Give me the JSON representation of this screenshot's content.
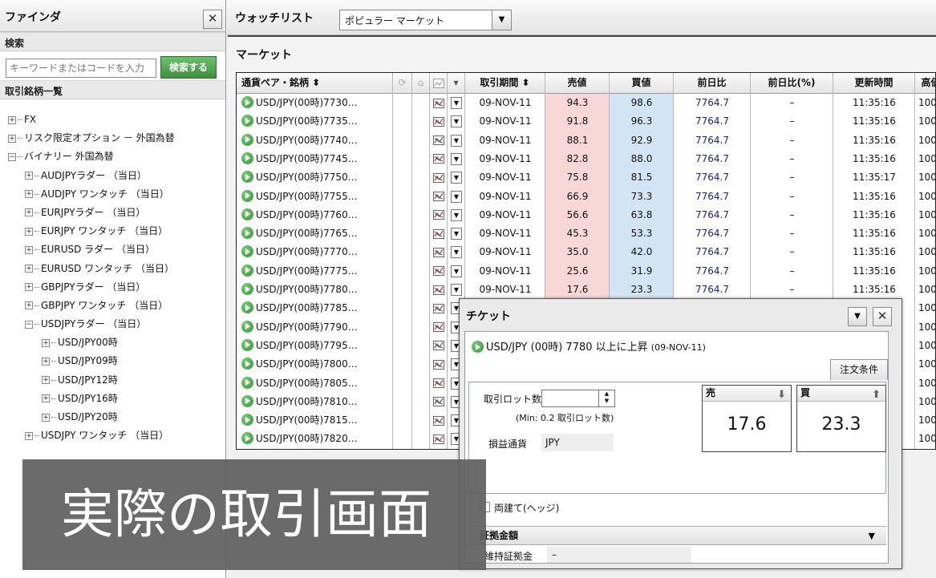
{
  "finder": {
    "title": "ファインダ",
    "close_label": "✕",
    "search_section": "検索",
    "search_placeholder": "キーワードまたはコードを入力",
    "search_button": "検索する",
    "list_section": "取引銘柄一覧",
    "tree": [
      {
        "level": 0,
        "label": "FX",
        "box": "+"
      },
      {
        "level": 0,
        "label": "リスク限定オプション － 外国為替",
        "box": "+"
      },
      {
        "level": 0,
        "label": "バイナリー 外国為替",
        "box": "−"
      },
      {
        "level": 1,
        "label": "AUDJPYラダー （当日）",
        "box": "+"
      },
      {
        "level": 1,
        "label": "AUDJPY ワンタッチ （当日）",
        "box": "+"
      },
      {
        "level": 1,
        "label": "EURJPYラダー （当日）",
        "box": "+"
      },
      {
        "level": 1,
        "label": "EURJPY ワンタッチ （当日）",
        "box": "+"
      },
      {
        "level": 1,
        "label": "EURUSD ラダー （当日）",
        "box": "+"
      },
      {
        "level": 1,
        "label": "EURUSD ワンタッチ （当日）",
        "box": "+"
      },
      {
        "level": 1,
        "label": "GBPJPYラダー （当日）",
        "box": "+"
      },
      {
        "level": 1,
        "label": "GBPJPY ワンタッチ （当日）",
        "box": "+"
      },
      {
        "level": 1,
        "label": "USDJPYラダー （当日）",
        "box": "−"
      },
      {
        "level": 2,
        "label": "USD/JPY00時",
        "box": "+"
      },
      {
        "level": 2,
        "label": "USD/JPY09時",
        "box": "+"
      },
      {
        "level": 2,
        "label": "USD/JPY12時",
        "box": "+"
      },
      {
        "level": 2,
        "label": "USD/JPY16時",
        "box": "+"
      },
      {
        "level": 2,
        "label": "USD/JPY20時",
        "box": "+"
      },
      {
        "level": 1,
        "label": "USDJPY ワンタッチ （当日）",
        "box": "+"
      }
    ]
  },
  "watchlist": {
    "title": "ウォッチリスト",
    "selected": "ポピュラー マーケット",
    "caret": "▼"
  },
  "market": {
    "title": "マーケット",
    "headers": [
      "通貨ペア・銘柄 ⬍",
      "",
      "",
      "",
      "▾",
      "取引期間 ⬍",
      "売値",
      "買値",
      "前日比",
      "前日比(%)",
      "更新時間",
      "高値"
    ],
    "rows": [
      {
        "sym": "USD/JPY(00時)7730…",
        "date": "09-NOV-11",
        "sell": "94.3",
        "buy": "98.6",
        "chg": "7764.7",
        "pct": "–",
        "time": "11:35:16",
        "high": "100"
      },
      {
        "sym": "USD/JPY(00時)7735…",
        "date": "09-NOV-11",
        "sell": "91.8",
        "buy": "96.3",
        "chg": "7764.7",
        "pct": "–",
        "time": "11:35:16",
        "high": "100"
      },
      {
        "sym": "USD/JPY(00時)7740…",
        "date": "09-NOV-11",
        "sell": "88.1",
        "buy": "92.9",
        "chg": "7764.7",
        "pct": "–",
        "time": "11:35:16",
        "high": "100"
      },
      {
        "sym": "USD/JPY(00時)7745…",
        "date": "09-NOV-11",
        "sell": "82.8",
        "buy": "88.0",
        "chg": "7764.7",
        "pct": "–",
        "time": "11:35:16",
        "high": "100"
      },
      {
        "sym": "USD/JPY(00時)7750…",
        "date": "09-NOV-11",
        "sell": "75.8",
        "buy": "81.5",
        "chg": "7764.7",
        "pct": "–",
        "time": "11:35:17",
        "high": "100"
      },
      {
        "sym": "USD/JPY(00時)7755…",
        "date": "09-NOV-11",
        "sell": "66.9",
        "buy": "73.3",
        "chg": "7764.7",
        "pct": "–",
        "time": "11:35:16",
        "high": "100"
      },
      {
        "sym": "USD/JPY(00時)7760…",
        "date": "09-NOV-11",
        "sell": "56.6",
        "buy": "63.8",
        "chg": "7764.7",
        "pct": "–",
        "time": "11:35:16",
        "high": "100"
      },
      {
        "sym": "USD/JPY(00時)7765…",
        "date": "09-NOV-11",
        "sell": "45.3",
        "buy": "53.3",
        "chg": "7764.7",
        "pct": "–",
        "time": "11:35:16",
        "high": "100"
      },
      {
        "sym": "USD/JPY(00時)7770…",
        "date": "09-NOV-11",
        "sell": "35.0",
        "buy": "42.0",
        "chg": "7764.7",
        "pct": "–",
        "time": "11:35:16",
        "high": "100"
      },
      {
        "sym": "USD/JPY(00時)7775…",
        "date": "09-NOV-11",
        "sell": "25.6",
        "buy": "31.9",
        "chg": "7764.7",
        "pct": "–",
        "time": "11:35:16",
        "high": "100"
      },
      {
        "sym": "USD/JPY(00時)7780…",
        "date": "09-NOV-11",
        "sell": "17.6",
        "buy": "23.3",
        "chg": "7764.7",
        "pct": "–",
        "time": "11:35:16",
        "high": "100"
      },
      {
        "sym": "USD/JPY(00時)7785…",
        "date": "",
        "sell": "",
        "buy": "",
        "chg": "",
        "pct": "",
        "time": "",
        "high": "100"
      },
      {
        "sym": "USD/JPY(00時)7790…",
        "date": "",
        "sell": "",
        "buy": "",
        "chg": "",
        "pct": "",
        "time": "",
        "high": "100"
      },
      {
        "sym": "USD/JPY(00時)7795…",
        "date": "",
        "sell": "",
        "buy": "",
        "chg": "",
        "pct": "",
        "time": "",
        "high": "100"
      },
      {
        "sym": "USD/JPY(00時)7800…",
        "date": "",
        "sell": "",
        "buy": "",
        "chg": "",
        "pct": "",
        "time": "",
        "high": "100"
      },
      {
        "sym": "USD/JPY(00時)7805…",
        "date": "",
        "sell": "",
        "buy": "",
        "chg": "",
        "pct": "",
        "time": "",
        "high": "100"
      },
      {
        "sym": "USD/JPY(00時)7810…",
        "date": "",
        "sell": "",
        "buy": "",
        "chg": "",
        "pct": "",
        "time": "",
        "high": "100"
      },
      {
        "sym": "USD/JPY(00時)7815…",
        "date": "",
        "sell": "",
        "buy": "",
        "chg": "",
        "pct": "",
        "time": "",
        "high": "100"
      },
      {
        "sym": "USD/JPY(00時)7820…",
        "date": "",
        "sell": "",
        "buy": "",
        "chg": "",
        "pct": "",
        "time": "",
        "high": "100"
      }
    ]
  },
  "ticket": {
    "title": "チケット",
    "caret": "▼",
    "close_label": "✕",
    "symbol": "USD/JPY (00時) 7780 以上に上昇",
    "symbol_date": "(09-NOV-11)",
    "tab": "注文条件",
    "lot_label": "取引ロット数",
    "lot_min": "(Min: 0.2 取引ロット数)",
    "ccy_label": "損益通貨",
    "ccy_value": "JPY",
    "sell_label": "売",
    "buy_label": "買",
    "sell_price": "17.6",
    "buy_price": "23.3",
    "hedge_label": "両建て(ヘッジ)",
    "margin_section": "証拠金額",
    "margin_label": "維持証拠金",
    "margin_value": "–"
  },
  "caption": "実際の取引画面",
  "colors": {
    "sell_bg": "#f8d7d7",
    "buy_bg": "#d3e4f5",
    "chg_text": "#1a237e",
    "search_btn": "#4a9e4a",
    "caption_bg": "#606060"
  }
}
